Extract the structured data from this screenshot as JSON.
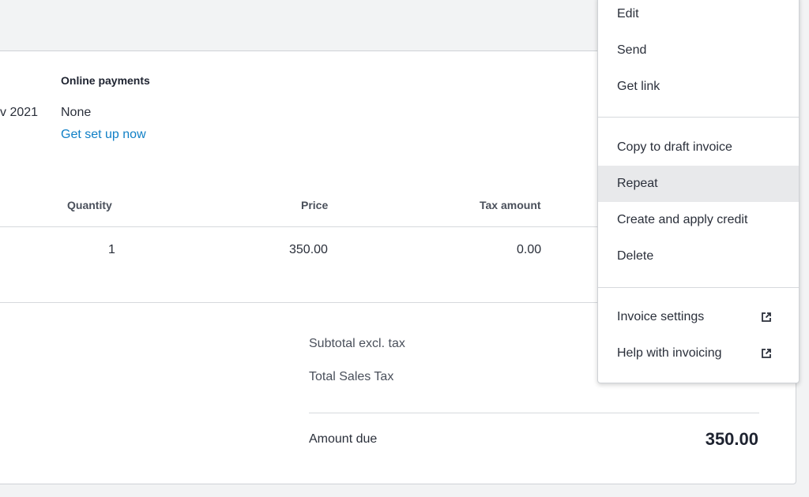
{
  "invoice": {
    "date_fragment": "v 2021",
    "online_payments_heading": "Online payments",
    "online_payments_value": "None",
    "setup_link": "Get set up now"
  },
  "table": {
    "headers": {
      "quantity": "Quantity",
      "price": "Price",
      "tax_amount": "Tax amount"
    },
    "rows": [
      {
        "quantity": "1",
        "price": "350.00",
        "tax_amount": "0.00"
      }
    ]
  },
  "summary": {
    "subtotal_label": "Subtotal excl. tax",
    "sales_tax_label": "Total Sales Tax",
    "amount_due_label": "Amount due",
    "amount_due_value": "350.00"
  },
  "menu": {
    "items": [
      {
        "label": "Edit"
      },
      {
        "label": "Send"
      },
      {
        "label": "Get link"
      },
      {
        "label": "Copy to draft invoice"
      },
      {
        "label": "Repeat",
        "active": true
      },
      {
        "label": "Create and apply credit"
      },
      {
        "label": "Delete"
      },
      {
        "label": "Invoice settings",
        "icon": "external-link-icon"
      },
      {
        "label": "Help with invoicing",
        "icon": "external-link-icon"
      }
    ]
  },
  "colors": {
    "link": "#0f7fc6",
    "menu_hover": "#e8e9eb",
    "page_bg": "#f2f3f4"
  }
}
